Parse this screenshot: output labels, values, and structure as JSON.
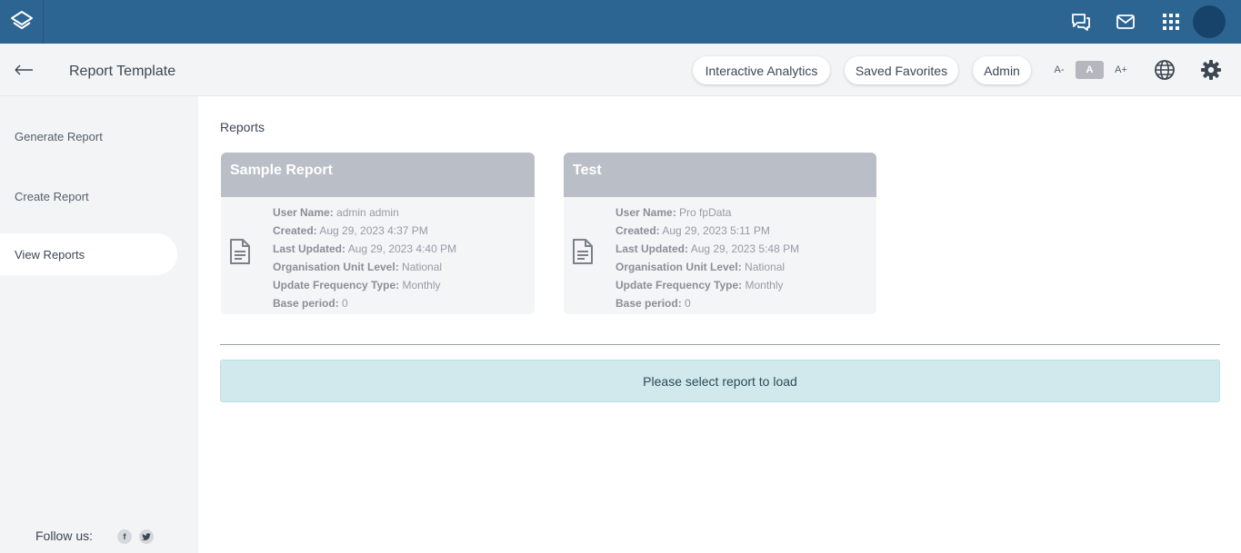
{
  "topbar": {
    "logo_icon": "layers-logo-icon",
    "icons": [
      "chat-icon",
      "mail-icon",
      "apps-grid-icon"
    ],
    "brand_color": "#2d6592"
  },
  "header": {
    "title": "Report Template",
    "pills": [
      "Interactive Analytics",
      "Saved Favorites",
      "Admin"
    ],
    "font_sizes": [
      "A-",
      "A",
      "A+"
    ],
    "active_font_size": "A"
  },
  "sidebar": {
    "items": [
      {
        "label": "Generate Report",
        "active": false
      },
      {
        "label": "Create Report",
        "active": false
      },
      {
        "label": "View Reports",
        "active": true
      }
    ],
    "follow_label": "Follow us:",
    "social": [
      "facebook-icon",
      "twitter-icon"
    ]
  },
  "main": {
    "heading": "Reports",
    "cards": [
      {
        "title": "Sample Report",
        "fields": [
          {
            "label": "User Name:",
            "value": "admin admin"
          },
          {
            "label": "Created:",
            "value": "Aug 29, 2023 4:37 PM"
          },
          {
            "label": "Last Updated:",
            "value": "Aug 29, 2023 4:40 PM"
          },
          {
            "label": "Organisation Unit Level:",
            "value": "National"
          },
          {
            "label": "Update Frequency Type:",
            "value": "Monthly"
          },
          {
            "label": "Base period:",
            "value": "0"
          }
        ]
      },
      {
        "title": "Test",
        "fields": [
          {
            "label": "User Name:",
            "value": "Pro fpData"
          },
          {
            "label": "Created:",
            "value": "Aug 29, 2023 5:11 PM"
          },
          {
            "label": "Last Updated:",
            "value": "Aug 29, 2023 5:48 PM"
          },
          {
            "label": "Organisation Unit Level:",
            "value": "National"
          },
          {
            "label": "Update Frequency Type:",
            "value": "Monthly"
          },
          {
            "label": "Base period:",
            "value": "0"
          }
        ]
      }
    ],
    "notice": "Please select report to load"
  }
}
